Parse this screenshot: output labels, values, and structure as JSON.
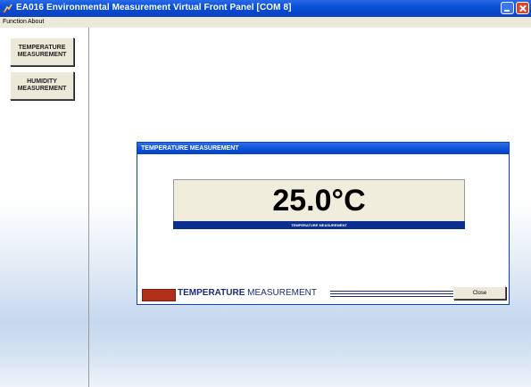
{
  "window": {
    "title": "EA016 Environmental Measurement Virtual Front Panel [COM 8]"
  },
  "menu": [
    {
      "label": "Function"
    },
    {
      "label": "About"
    }
  ],
  "sidebar": {
    "buttons": [
      {
        "line1": "TEMPERATURE",
        "line2": "MEASUREMENT"
      },
      {
        "line1": "HUMIDITY",
        "line2": "MEASUREMENT"
      }
    ]
  },
  "dialog": {
    "title": "TEMPERATURE MEASUREMENT",
    "value": "25.0°C",
    "value_caption": "TEMPERATURE MEASUREMENT",
    "brand_bold": "TEMPERATURE",
    "brand_rest": "MEASUREMENT",
    "close_label": "Close"
  },
  "colors": {
    "titlebar": "#0a4fd6",
    "strip": "#0a2f8e",
    "brand_text": "#1d2a7a",
    "logo": "#b0301a"
  }
}
